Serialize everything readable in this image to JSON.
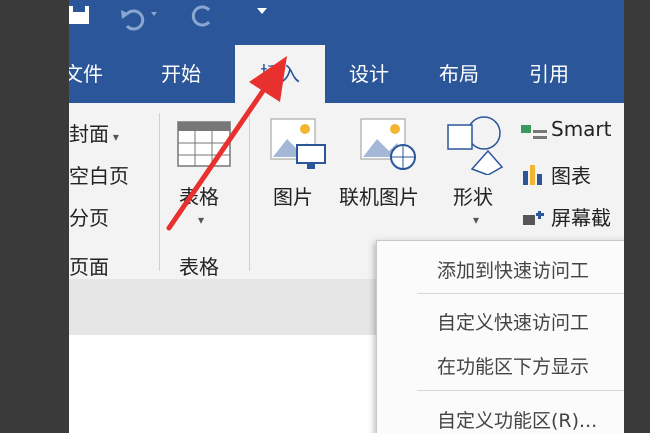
{
  "tabs": [
    "文件",
    "开始",
    "插入",
    "设计",
    "布局",
    "引用"
  ],
  "pages_group": {
    "items": [
      "封面",
      "空白页",
      "分页"
    ],
    "group_label": "页面"
  },
  "table_group": {
    "button_label": "表格",
    "group_label": "表格"
  },
  "illustrations": {
    "picture_label": "图片",
    "online_picture_label": "联机图片",
    "shapes_label": "形状",
    "smartart_label": "Smart",
    "chart_label": "图表",
    "screenshot_label": "屏幕截"
  },
  "context_menu": {
    "items": [
      "添加到快速访问工",
      "自定义快速访问工",
      "在功能区下方显示",
      "自定义功能区(R)..."
    ]
  },
  "colors": {
    "ribbon_blue": "#2b579a",
    "ribbon_bg": "#f3f3f3",
    "arrow_red": "#e8312f"
  }
}
